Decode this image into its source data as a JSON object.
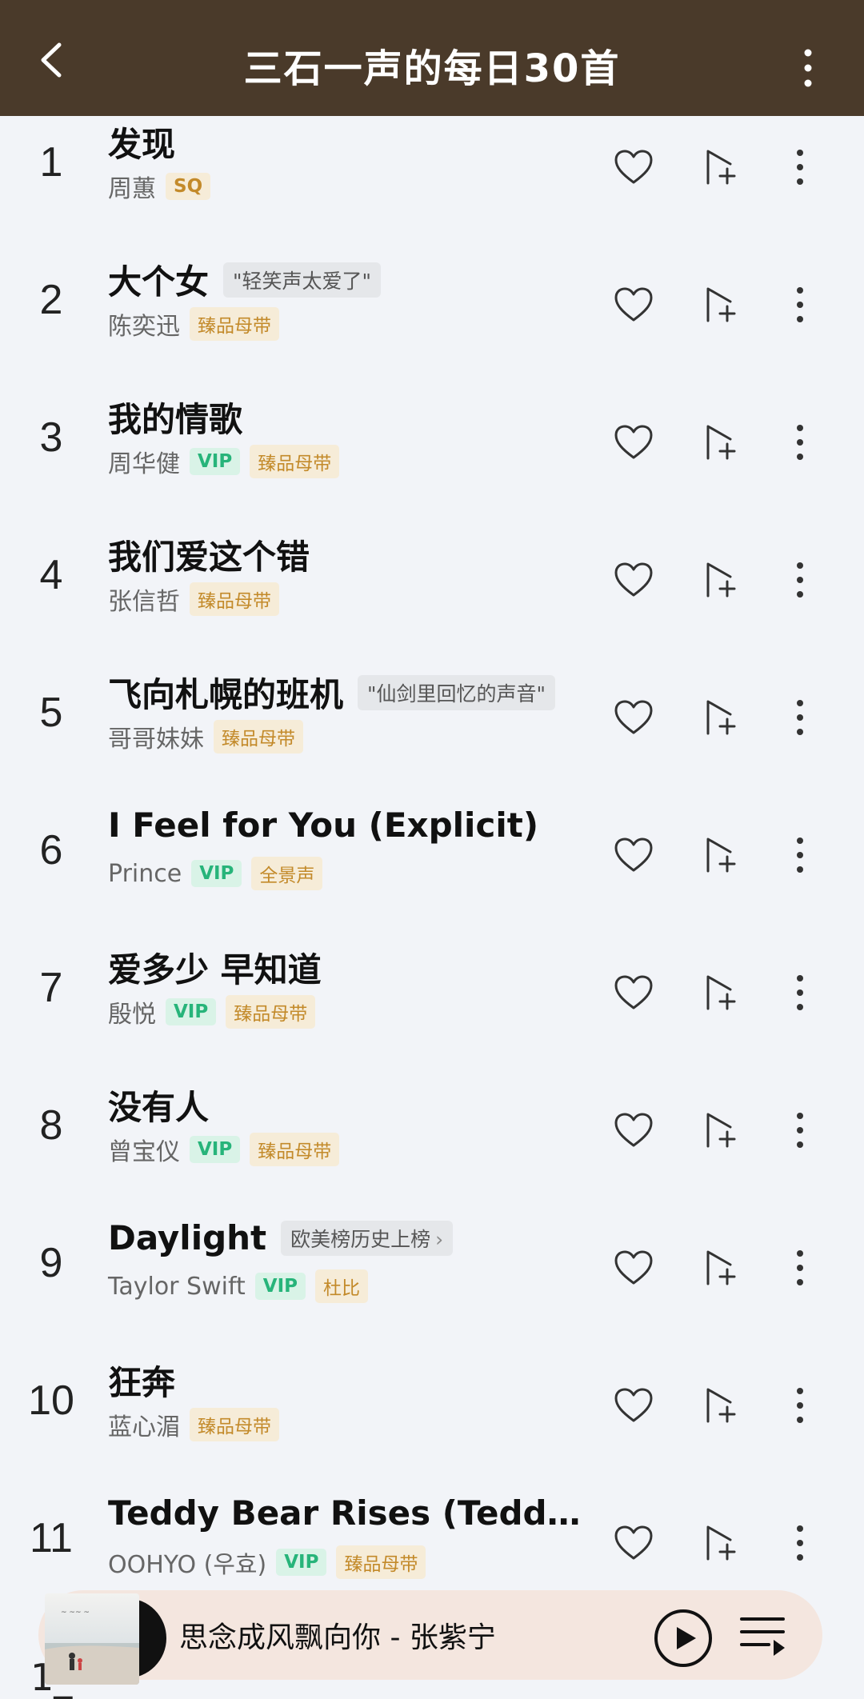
{
  "header": {
    "title": "三石一声的每日30首"
  },
  "songs": [
    {
      "index": "1",
      "title": "发现",
      "artist": "周蕙",
      "badges": [
        {
          "type": "sq",
          "text": "SQ"
        }
      ]
    },
    {
      "index": "2",
      "title": "大个女",
      "note": "\"轻笑声太爱了\"",
      "artist": "陈奕迅",
      "badges": [
        {
          "type": "gold",
          "text": "臻品母带"
        }
      ]
    },
    {
      "index": "3",
      "title": "我的情歌",
      "artist": "周华健",
      "badges": [
        {
          "type": "vip",
          "text": "VIP"
        },
        {
          "type": "gold",
          "text": "臻品母带"
        }
      ]
    },
    {
      "index": "4",
      "title": "我们爱这个错",
      "artist": "张信哲",
      "badges": [
        {
          "type": "gold",
          "text": "臻品母带"
        }
      ]
    },
    {
      "index": "5",
      "title": "飞向札幌的班机",
      "note": "\"仙剑里回忆的声音\"",
      "artist": "哥哥妹妹",
      "badges": [
        {
          "type": "gold",
          "text": "臻品母带"
        }
      ]
    },
    {
      "index": "6",
      "title": "I Feel for You (Explicit)",
      "artist": "Prince",
      "badges": [
        {
          "type": "vip",
          "text": "VIP"
        },
        {
          "type": "gold",
          "text": "全景声"
        }
      ]
    },
    {
      "index": "7",
      "title": "爱多少 早知道",
      "artist": "殷悦",
      "badges": [
        {
          "type": "vip",
          "text": "VIP"
        },
        {
          "type": "gold",
          "text": "臻品母带"
        }
      ]
    },
    {
      "index": "8",
      "title": "没有人",
      "artist": "曾宝仪",
      "badges": [
        {
          "type": "vip",
          "text": "VIP"
        },
        {
          "type": "gold",
          "text": "臻品母带"
        }
      ]
    },
    {
      "index": "9",
      "title": "Daylight",
      "note": "欧美榜历史上榜",
      "note_chevron": true,
      "artist": "Taylor Swift",
      "badges": [
        {
          "type": "vip",
          "text": "VIP"
        },
        {
          "type": "gold",
          "text": "杜比"
        }
      ]
    },
    {
      "index": "10",
      "title": "狂奔",
      "artist": "蓝心湄",
      "badges": [
        {
          "type": "gold",
          "text": "臻品母带"
        }
      ]
    },
    {
      "index": "11",
      "title": "Teddy Bear Rises (Teddy Be...",
      "artist": "OOHYO (우효)",
      "badges": [
        {
          "type": "vip",
          "text": "VIP"
        },
        {
          "type": "gold",
          "text": "臻品母带"
        }
      ]
    }
  ],
  "player": {
    "now_playing": "思念成风飘向你 - 张紫宁"
  },
  "peek_index": "1_"
}
